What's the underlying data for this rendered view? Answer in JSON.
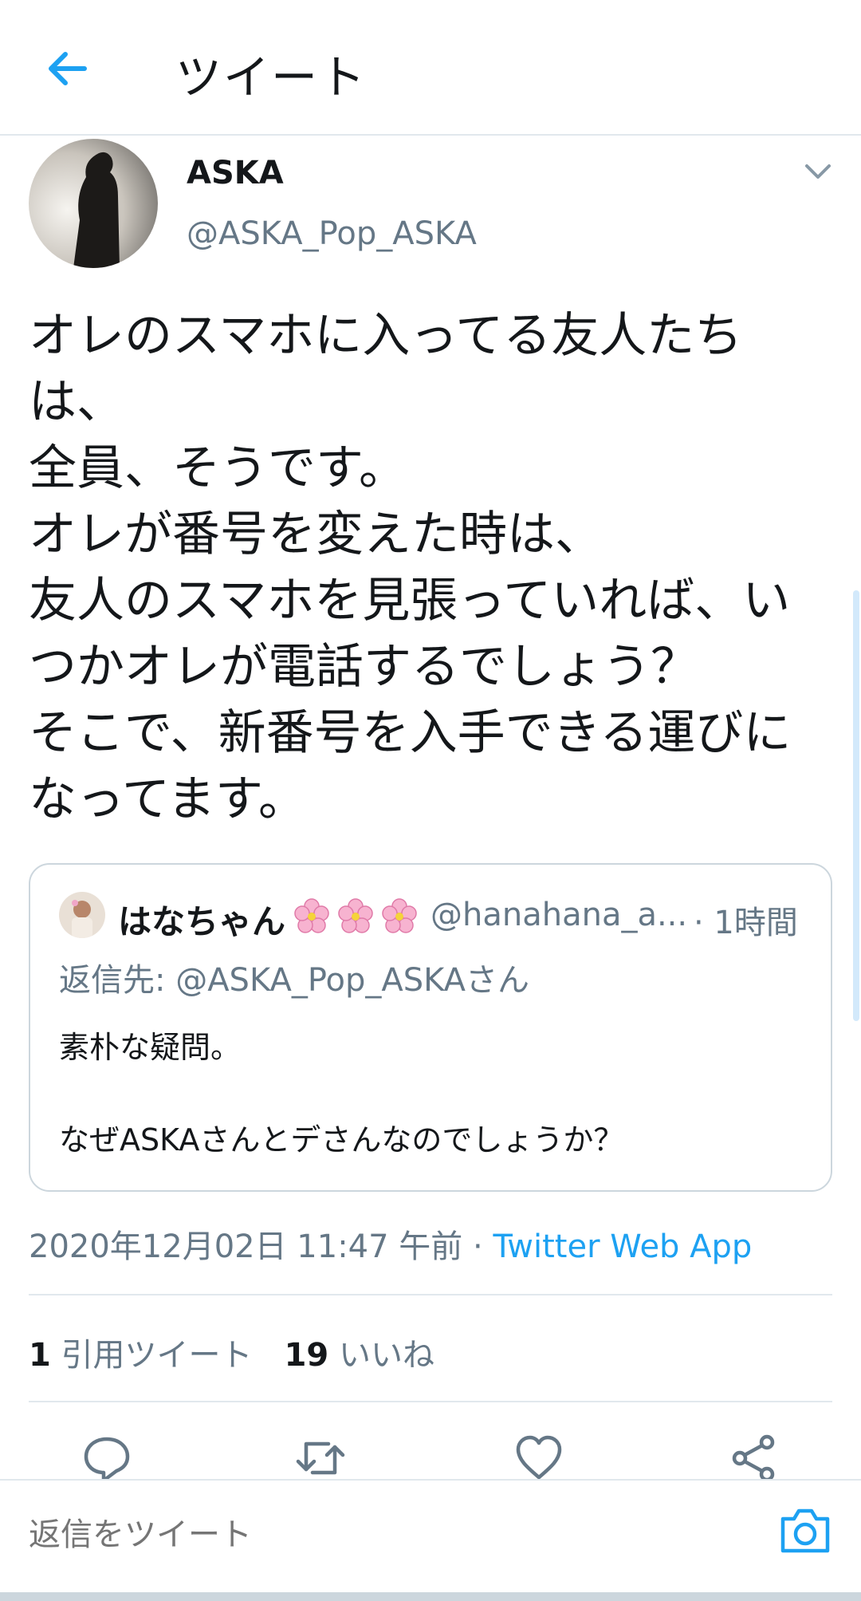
{
  "header": {
    "title": "ツイート",
    "back_icon": "arrow-left-icon"
  },
  "author": {
    "name": "ASKA",
    "handle": "@ASKA_Pop_ASKA"
  },
  "tweet": {
    "text": "オレのスマホに入ってる友人たち\nは、\n全員、そうです。\nオレが番号を変えた時は、\n友人のスマホを見張っていれば、い\nつかオレが電話するでしょう？\nそこで、新番号を入手できる運びに\nなってます。"
  },
  "quote": {
    "name": "はなちゃん",
    "handle": "@hanahana_a...",
    "time": "· 1時間",
    "reply_to": "返信先: @ASKA_Pop_ASKAさん",
    "text": "素朴な疑問。\n\nなぜASKAさんとデさんなのでしょうか？"
  },
  "meta": {
    "datetime": "2020年12月02日 11:47 午前 · ",
    "source": "Twitter Web App"
  },
  "stats": {
    "quote_count": "1",
    "quote_label": "引用ツイート",
    "like_count": "19",
    "like_label": "いいね"
  },
  "actions": [
    "reply-icon",
    "retweet-icon",
    "like-icon",
    "share-icon"
  ],
  "reply_bar": {
    "placeholder": "返信をツイート"
  },
  "colors": {
    "accent": "#1da1f2",
    "secondary_text": "#657786",
    "divider": "#e1e8ed"
  }
}
